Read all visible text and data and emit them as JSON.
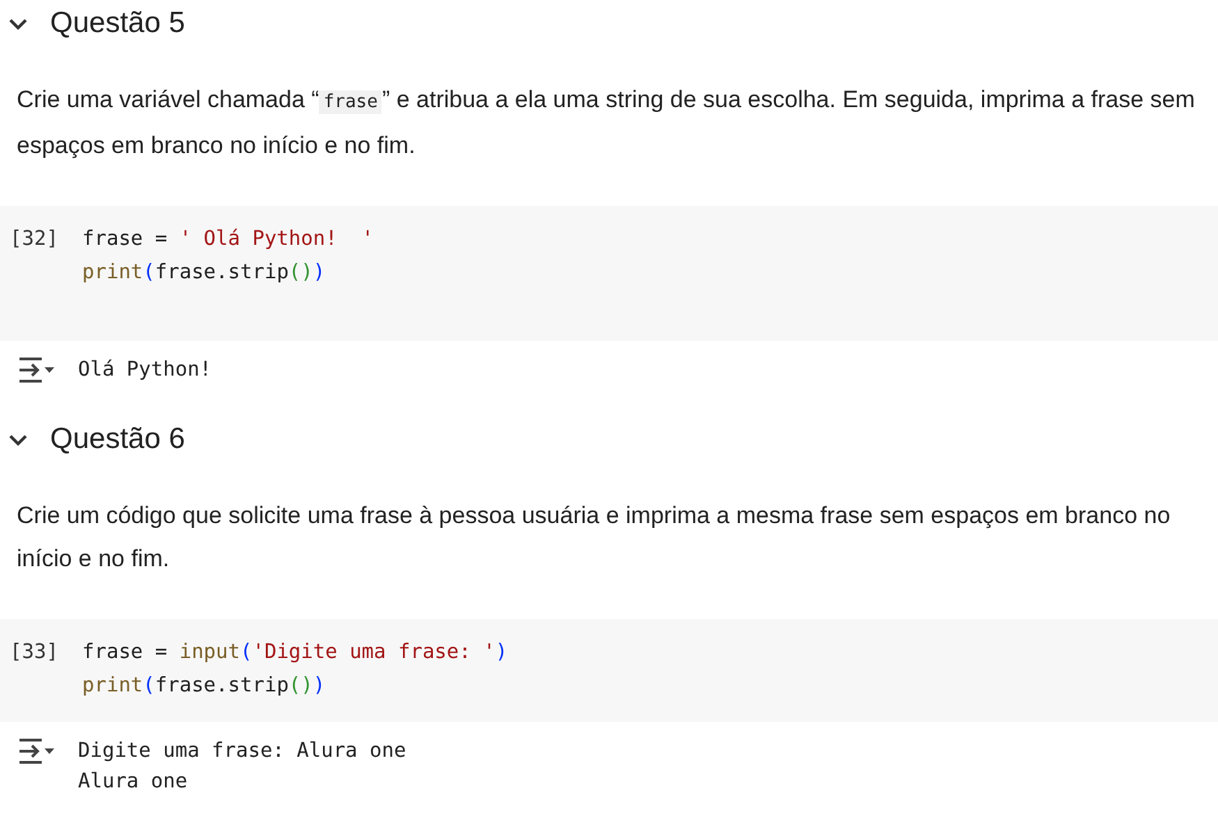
{
  "sections": [
    {
      "heading": "Questão 5",
      "expanded": true,
      "description": [
        {
          "kind": "text",
          "text": "Crie uma variável chamada “"
        },
        {
          "kind": "code",
          "text": "frase"
        },
        {
          "kind": "text",
          "text": "” e atribua a ela uma string de sua escolha. Em seguida, imprima a frase sem espaços em branco no início e no fim."
        }
      ],
      "cell": {
        "execution_count": "[32]",
        "lines": [
          [
            {
              "kind": "name",
              "text": "frase = "
            },
            {
              "kind": "string",
              "text": "' Olá Python!  '"
            }
          ],
          [
            {
              "kind": "function",
              "text": "print"
            },
            {
              "kind": "bracket1",
              "text": "("
            },
            {
              "kind": "name",
              "text": "frase.strip"
            },
            {
              "kind": "bracket2",
              "text": "()"
            },
            {
              "kind": "bracket1",
              "text": ")"
            }
          ]
        ],
        "output": [
          "Olá Python!"
        ]
      }
    },
    {
      "heading": "Questão 6",
      "expanded": true,
      "description": [
        {
          "kind": "text",
          "text": "Crie um código que solicite uma frase à pessoa usuária e imprima a mesma frase sem espaços em branco no início e no fim."
        }
      ],
      "cell": {
        "execution_count": "[33]",
        "lines": [
          [
            {
              "kind": "name",
              "text": "frase = "
            },
            {
              "kind": "function",
              "text": "input"
            },
            {
              "kind": "bracket1",
              "text": "("
            },
            {
              "kind": "string",
              "text": "'Digite uma frase: '"
            },
            {
              "kind": "bracket1",
              "text": ")"
            }
          ],
          [
            {
              "kind": "function",
              "text": "print"
            },
            {
              "kind": "bracket1",
              "text": "("
            },
            {
              "kind": "name",
              "text": "frase.strip"
            },
            {
              "kind": "bracket2",
              "text": "()"
            },
            {
              "kind": "bracket1",
              "text": ")"
            }
          ]
        ],
        "output": [
          "Digite uma frase: Alura one",
          "Alura one"
        ]
      }
    }
  ]
}
